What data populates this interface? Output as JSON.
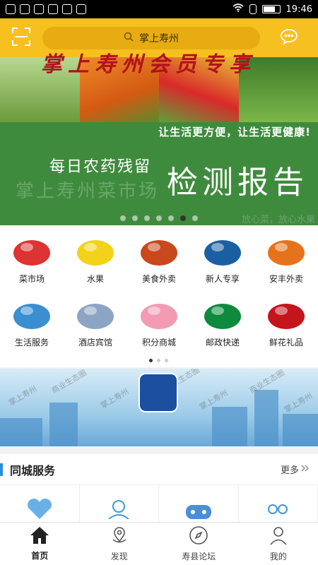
{
  "status_bar": {
    "time": "19:46"
  },
  "header": {
    "search_text": "掌上寿州"
  },
  "banner": {
    "slogan": "让生活更方便，让生活更健康!",
    "subtitle": "每日农药残留",
    "title": "检测报告",
    "market": "掌上寿州菜市场",
    "tagline": "放心菜，放心水果",
    "dot_count": 7,
    "active_dot": 5,
    "colors": [
      "#5a9a3a",
      "#8fb85a",
      "#b7d67a",
      "#3a7a2a"
    ]
  },
  "grid": {
    "items": [
      {
        "label": "菜市场",
        "icon": "vegetables-icon",
        "color": "#d33"
      },
      {
        "label": "水果",
        "icon": "lemon-icon",
        "color": "#f3d21a"
      },
      {
        "label": "美食外卖",
        "icon": "hotpot-icon",
        "color": "#c9481c"
      },
      {
        "label": "新人专享",
        "icon": "new-user-icon",
        "color": "#1b5fa3"
      },
      {
        "label": "安丰外卖",
        "icon": "coffee-icon",
        "color": "#e6731c"
      },
      {
        "label": "生活服务",
        "icon": "cleaning-icon",
        "color": "#3b8fd0"
      },
      {
        "label": "酒店宾馆",
        "icon": "hotel-icon",
        "color": "#8da5c4"
      },
      {
        "label": "积分商城",
        "icon": "piggy-bank-icon",
        "color": "#f29bb2"
      },
      {
        "label": "邮政快递",
        "icon": "post-icon",
        "color": "#0d8a3e"
      },
      {
        "label": "鲜花礼品",
        "icon": "rose-icon",
        "color": "#c4141c"
      }
    ],
    "page_count": 3,
    "active_page": 0
  },
  "vip": {
    "title": "掌上寿州会员专享",
    "watermarks": [
      "掌上寿州",
      "商业生态圈"
    ]
  },
  "services": {
    "heading": "同城服务",
    "more": "更多",
    "items": [
      "heart-hands-icon",
      "courier-icon",
      "gamepad-icon",
      "people-icon"
    ]
  },
  "tabbar": {
    "items": [
      {
        "label": "首页",
        "icon": "home-icon"
      },
      {
        "label": "发现",
        "icon": "location-icon"
      },
      {
        "label": "寿县论坛",
        "icon": "compass-icon"
      },
      {
        "label": "我的",
        "icon": "user-icon"
      }
    ]
  }
}
